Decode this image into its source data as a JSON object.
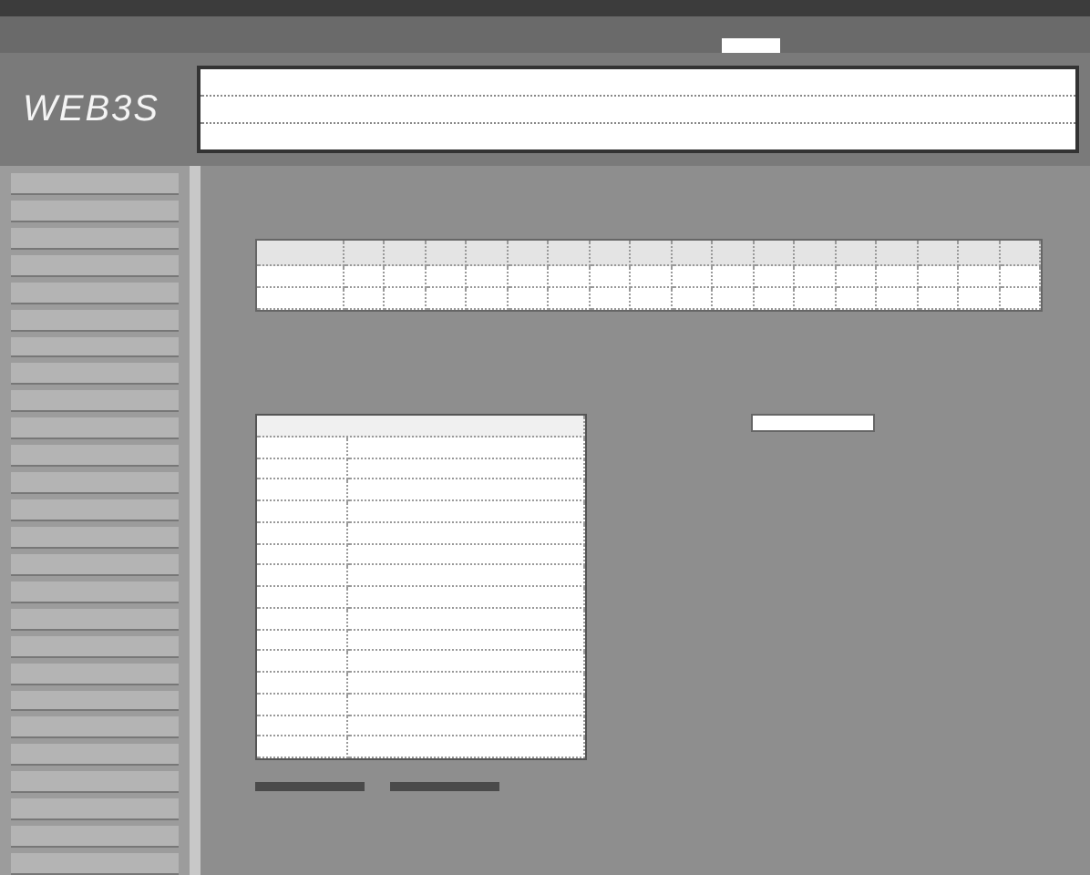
{
  "header": {
    "logo": "WEB3S"
  }
}
